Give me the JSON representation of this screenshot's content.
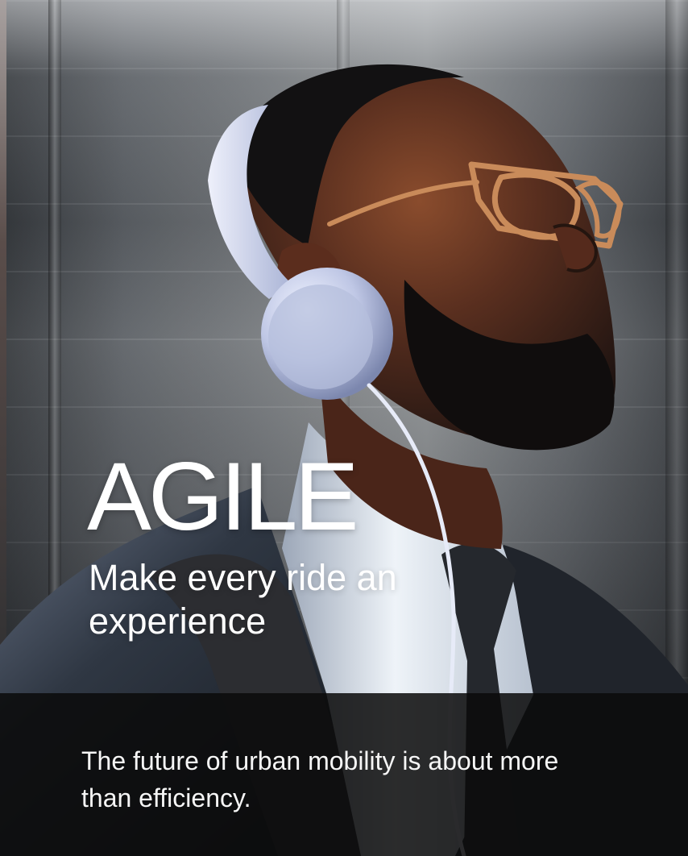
{
  "hero": {
    "title": "AGILE",
    "subtitle": "Make every ride an experience"
  },
  "caption": {
    "text": "The future of urban mobility is about more than efficiency."
  },
  "colors": {
    "text": "#ffffff",
    "caption_background": "#0a0a0a",
    "headphones": "#c9d0e8"
  }
}
